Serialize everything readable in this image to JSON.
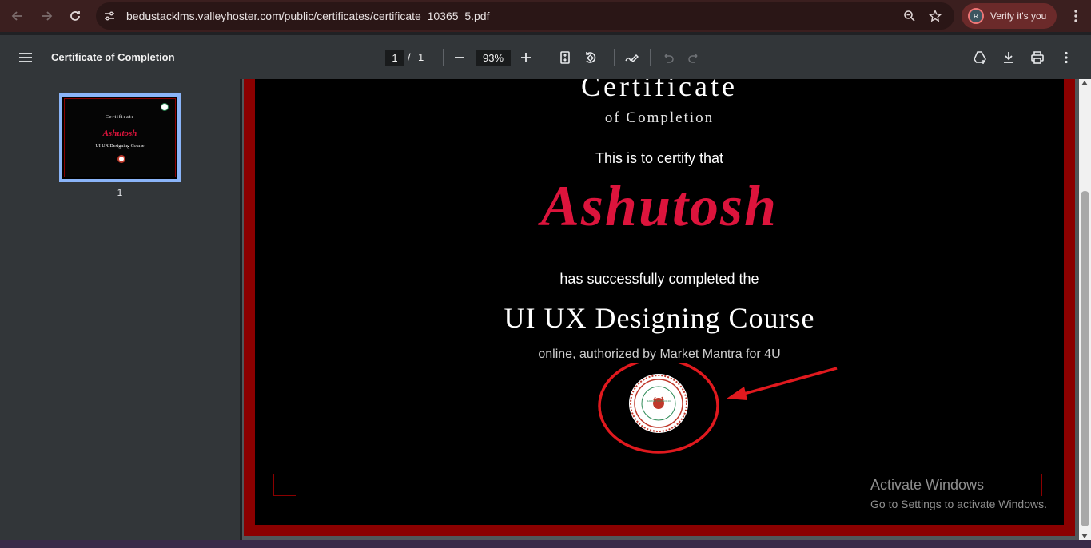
{
  "browser": {
    "url": "bedustacklms.valleyhoster.com/public/certificates/certificate_10365_5.pdf",
    "verify_label": "Verify it's you",
    "avatar_letter": "R"
  },
  "toolbar": {
    "title": "Certificate of Completion",
    "page_current": "1",
    "page_sep": "/",
    "page_total": "1",
    "zoom": "93%"
  },
  "sidebar": {
    "thumb_label": "1",
    "thumb_title": "Certificate",
    "thumb_name": "Ashutosh",
    "thumb_course": "UI UX Designing Course"
  },
  "certificate": {
    "title": "Certificate",
    "subtitle": "of Completion",
    "certify": "This is to certify that",
    "name": "Ashutosh",
    "completed": "has successfully completed the",
    "course": "UI UX Designing Course",
    "authorized": "online, authorized by Market Mantra for 4U",
    "seal_text": "MARKET MANTRA 4U"
  },
  "windows_notice": {
    "title": "Activate Windows",
    "subtitle": "Go to Settings to activate Windows."
  },
  "colors": {
    "accent_red": "#dc143c",
    "border_red": "#8b0000",
    "annotation_red": "#e0191e",
    "thumb_highlight": "#8ab4f8"
  }
}
